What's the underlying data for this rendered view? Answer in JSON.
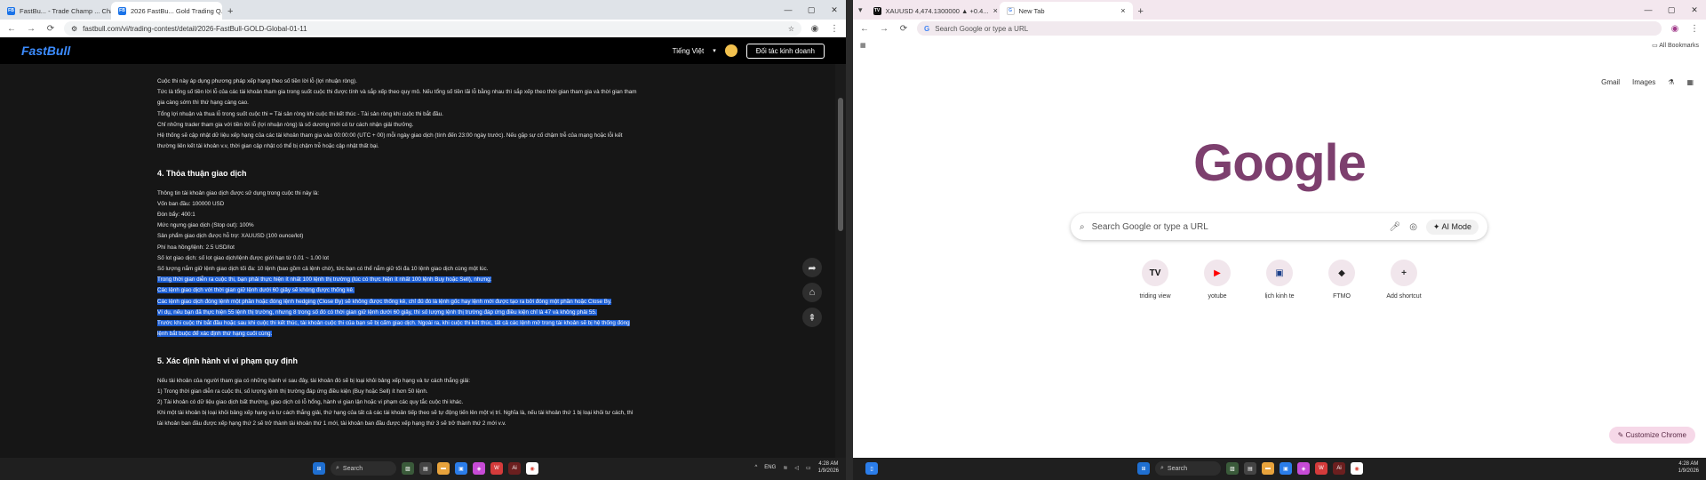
{
  "left": {
    "tabs": [
      {
        "label": "FastBu... - Trade Champ ... Chat",
        "fav": "FB",
        "active": false
      },
      {
        "label": "2026 FastBu... Gold Trading Q...",
        "fav": "FB",
        "active": true
      }
    ],
    "url": "fastbull.com/vi/trading-contest/detail/2026-FastBull-GOLD-Global-01-11",
    "brand": "FastBull",
    "language": "Tiếng Việt",
    "partner_button": "Đối tác kinh doanh",
    "intro": [
      "Cuộc thi này áp dụng phương pháp xếp hạng theo số tiền lời lỗ (lợi nhuận ròng).",
      "Tức là tổng số tiền lời lỗ của các tài khoản tham gia trong suốt cuộc thi được tính và sắp xếp theo quy mô. Nếu tổng số tiền lãi lỗ bằng nhau thì sắp xếp theo thời gian tham gia và thời gian tham",
      "gia càng sớm thì thứ hạng càng cao.",
      "Tổng lợi nhuận và thua lỗ trong suốt cuộc thi = Tài sản ròng khi cuộc thi kết thúc - Tài sản ròng khi cuộc thi bắt đầu.",
      "Chỉ những trader tham gia với tiền lời lỗ (lợi nhuận ròng) là số dương mới có tư cách nhận giải thưởng.",
      "Hệ thống sẽ cập nhật dữ liệu xếp hạng của các tài khoản tham gia vào 00:00:00 (UTC + 00) mỗi ngày giao dịch (tính đến 23:00 ngày trước). Nếu gặp sự cố chậm trễ của mạng hoặc lỗi kết",
      "thường liên kết tài khoản v.v, thời gian cập nhật có thể bị chậm trễ hoặc cập nhật thất bại."
    ],
    "section4_title": "4. Thỏa thuận giao dịch",
    "section4_lines": [
      "Thông tin tài khoản giao dịch được sử dụng trong cuộc thi này là:",
      " Vốn ban đầu: 100000 USD",
      " Đòn bẩy: 400:1",
      " Mức ngưng giao dịch (Stop out): 100%",
      " Sản phẩm giao dịch được hỗ trợ: XAUUSD (100 ounce/lot)",
      " Phí hoa hồng/lệnh: 2.5 USD/lot",
      " Số lot giao dịch: số lot giao dịch/lệnh được giới hạn từ 0.01 ~ 1.00 lot",
      " Số lượng nắm giữ lệnh giao dịch tối đa: 10 lệnh (bao gồm cả lệnh chờ), tức bạn có thể nắm giữ tối đa 10 lệnh giao dịch cùng một lúc."
    ],
    "section4_selected": [
      "Trong thời gian diễn ra cuộc thi, bạn phải thực hiện ít nhất 100 lệnh thị trường (lúc có thực hiện ít nhất 100 lệnh Buy hoặc Sell), nhưng:",
      " Các lệnh giao dịch với thời gian giữ lệnh dưới 60 giây sẽ không được thống kê.",
      " Các lệnh giao dịch đóng lệnh một phần hoặc đóng lệnh hedging (Close By) sẽ không được thống kê, chỉ đủ đó là lệnh gốc hay lệnh mới được tạo ra bởi đóng một phần hoặc Close By.",
      "Ví dụ, nếu bạn đã thực hiện 55 lệnh thị trường, nhưng 8 trong số đó có thời gian giữ lệnh dưới 60 giây, thì số lượng lệnh thị trường đáp ứng điều kiện chỉ là 47 và không phải 55.",
      "Trước khi cuộc thi bắt đầu hoặc sau khi cuộc thi kết thúc, tài khoản cuộc thi của bạn sẽ bị cấm giao dịch. Ngoài ra, khi cuộc thi kết thúc, tất cả các lệnh mở trong tài khoản sẽ bị hệ thống đóng",
      "lệnh bắt buộc để xác định thứ hạng cuối cùng."
    ],
    "section5_title": "5. Xác định hành vi vi phạm quy định",
    "section5_lines": [
      "Nếu tài khoản của người tham gia có những hành vi sau đây, tài khoản đó sẽ bị loại khỏi bảng xếp hạng và tư cách thắng giải:",
      "1) Trong thời gian diễn ra cuộc thi, số lượng lệnh thị trường đáp ứng điều kiện (Buy hoặc Sell) ít hơn 50 lệnh.",
      "2) Tài khoản có dữ liệu giao dịch bất thường, giao dịch có lỗ hổng, hành vi gian lận hoặc vi phạm các quy tắc cuộc thi khác.",
      "Khi một tài khoản bị loại khỏi bảng xếp hạng và tư cách thắng giải, thứ hạng của tất cả các tài khoản tiếp theo sẽ tự động tiến lên một vị trí. Nghĩa là, nếu tài khoản thứ 1 bị loại khỏi tư cách, thì",
      "tài khoản ban đầu được xếp hạng thứ 2 sẽ trở thành tài khoản thứ 1 mới, tài khoản ban đầu được xếp hạng thứ 3 sẽ trở thành thứ 2 mới v.v."
    ]
  },
  "right": {
    "tabs": [
      {
        "label": "XAUUSD 4,474.1300000 ▲ +0.4...",
        "fav": "TV",
        "active": false
      },
      {
        "label": "New Tab",
        "fav": "G",
        "active": true
      }
    ],
    "omnibox_placeholder": "Search Google or type a URL",
    "all_bookmarks": "All Bookmarks",
    "top_links": [
      "Gmail",
      "Images"
    ],
    "logo": "Google",
    "search_placeholder": "Search Google or type a URL",
    "ai_mode": "AI Mode",
    "shortcuts": [
      {
        "label": "triding view",
        "glyph": "TV",
        "color": "#111111"
      },
      {
        "label": "yotube",
        "glyph": "▶",
        "color": "#ff0000"
      },
      {
        "label": "lịch kinh te",
        "glyph": "▣",
        "color": "#1a3f8a"
      },
      {
        "label": "FTMO",
        "glyph": "◆",
        "color": "#222222"
      },
      {
        "label": "Add shortcut",
        "glyph": "+",
        "color": "#333333"
      }
    ],
    "customize": "Customize Chrome"
  },
  "taskbar": {
    "search_label": "Search",
    "lang": "ENG",
    "time": "4:28 AM",
    "date": "1/9/2026"
  }
}
